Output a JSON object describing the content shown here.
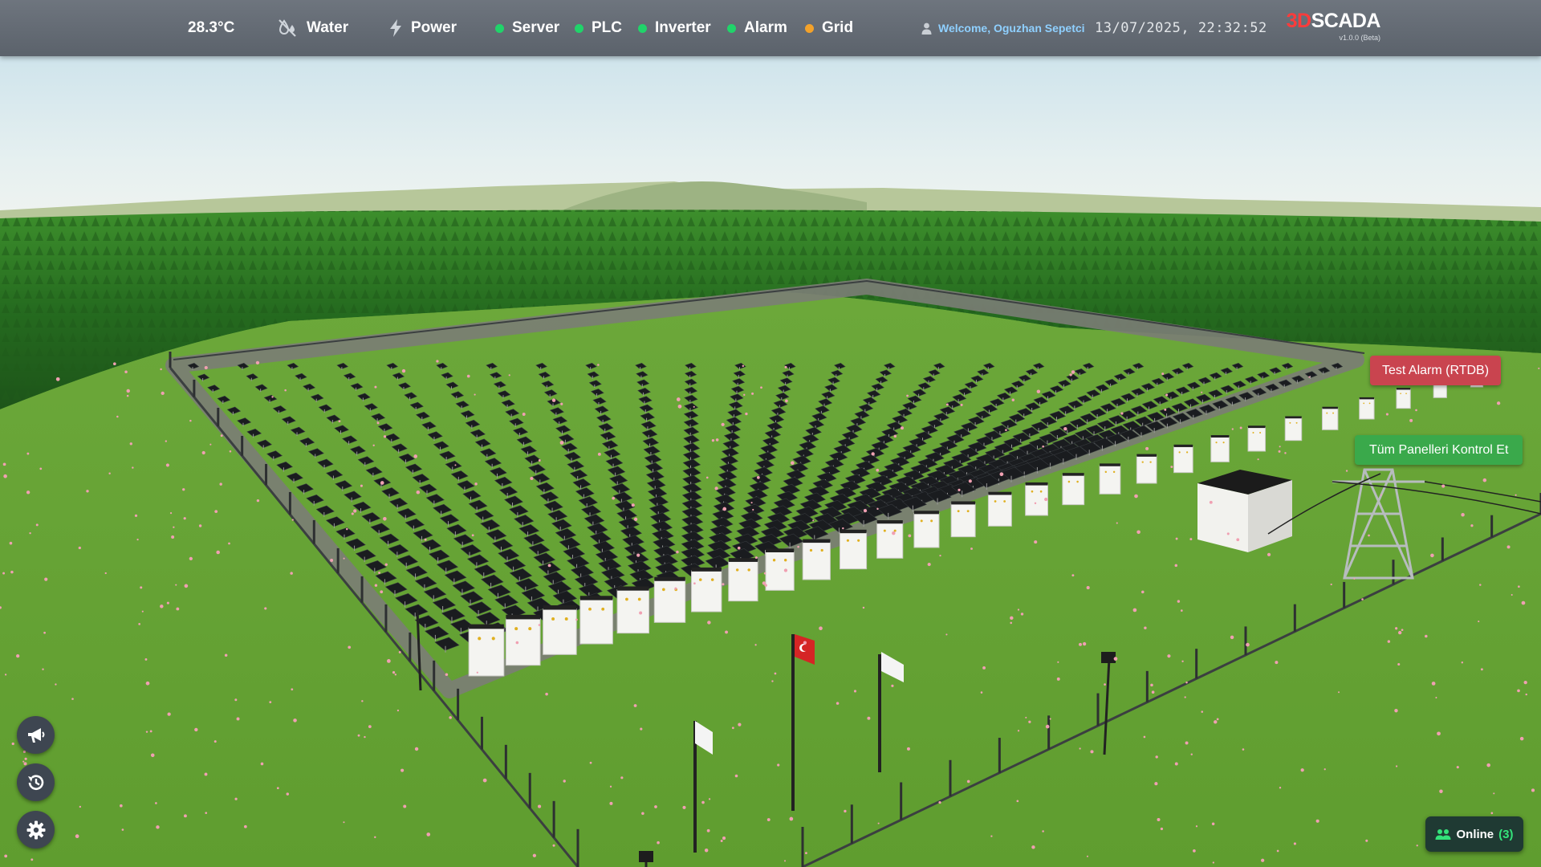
{
  "topbar": {
    "temperature": "28.3°C",
    "water_label": "Water",
    "power_label": "Power",
    "statuses": [
      {
        "label": "Server",
        "color": "#20d46a"
      },
      {
        "label": "PLC",
        "color": "#20d46a"
      },
      {
        "label": "Inverter",
        "color": "#20d46a"
      },
      {
        "label": "Alarm",
        "color": "#20d46a"
      },
      {
        "label": "Grid",
        "color": "#f3a22a"
      }
    ],
    "welcome": "Welcome, Oguzhan Sepetci",
    "datetime": "13/07/2025, 22:32:52",
    "brand": {
      "part1": "3D",
      "part2": "SCADA",
      "version": "v1.0.0 (Beta)"
    }
  },
  "scene": {
    "alarm_button": "Test Alarm (RTDB)",
    "control_button": "Tüm Panelleri Kontrol Et"
  },
  "side_tools": [
    {
      "name": "megaphone-icon"
    },
    {
      "name": "history-icon"
    },
    {
      "name": "gear-icon"
    }
  ],
  "online": {
    "label": "Online",
    "count": "(3)"
  },
  "colors": {
    "topbar": "#5f666f",
    "grass": "#6aa838",
    "alarm": "#c9444f",
    "control": "#3aa94b",
    "status_ok": "#20d46a",
    "status_warn": "#f3a22a",
    "brand_accent": "#ff3b3b"
  }
}
